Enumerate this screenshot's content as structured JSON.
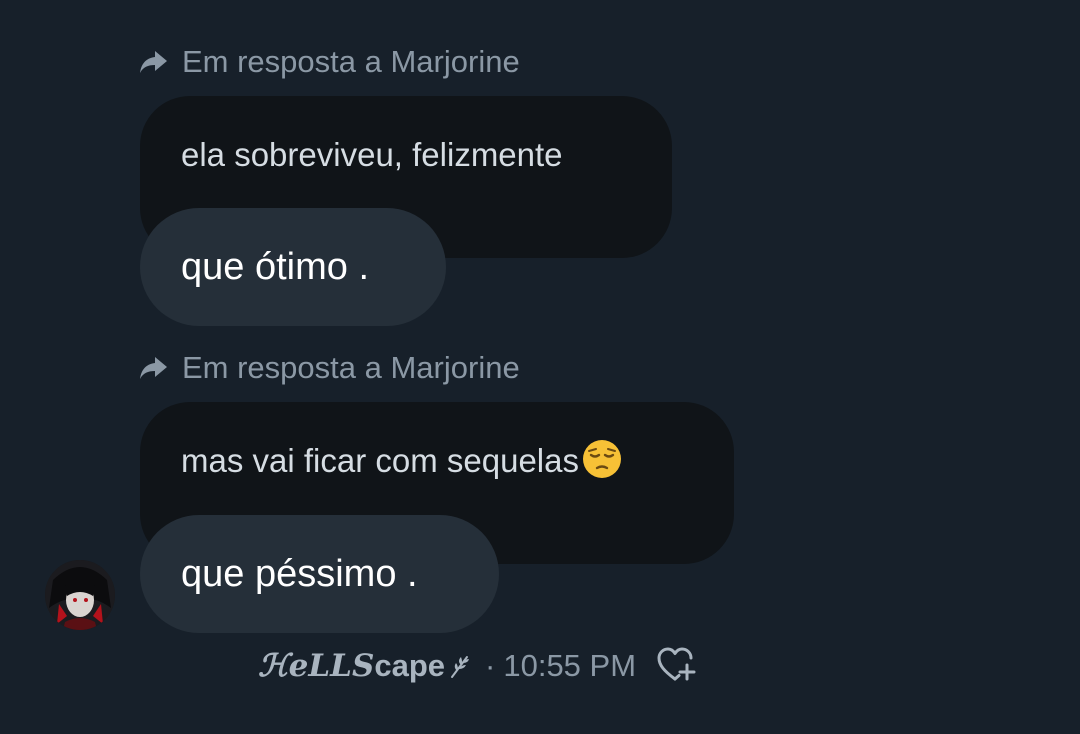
{
  "messages": [
    {
      "reply_label": "Em resposta a Marjorine",
      "quoted_text": "ela sobreviveu, felizmente",
      "reply_text": "que ótimo ."
    },
    {
      "reply_label": "Em resposta a Marjorine",
      "quoted_text": "mas vai ficar com sequelas",
      "quoted_emoji": "pensive-face-emoji",
      "reply_text": "que péssimo ."
    }
  ],
  "footer": {
    "sender_name_part1": "ℋeLLS",
    "sender_name_part2": "cape",
    "separator": "·",
    "timestamp": "10:55 PM"
  },
  "icons": {
    "reply": "reply-arrow-icon",
    "react": "heart-plus-icon",
    "name_decoration": "leaf-icon"
  },
  "colors": {
    "background": "#17202a",
    "quoted_bubble": "#101418",
    "reply_bubble": "#252f39",
    "muted_text": "#8b98a5",
    "emoji": "#f7c136"
  }
}
